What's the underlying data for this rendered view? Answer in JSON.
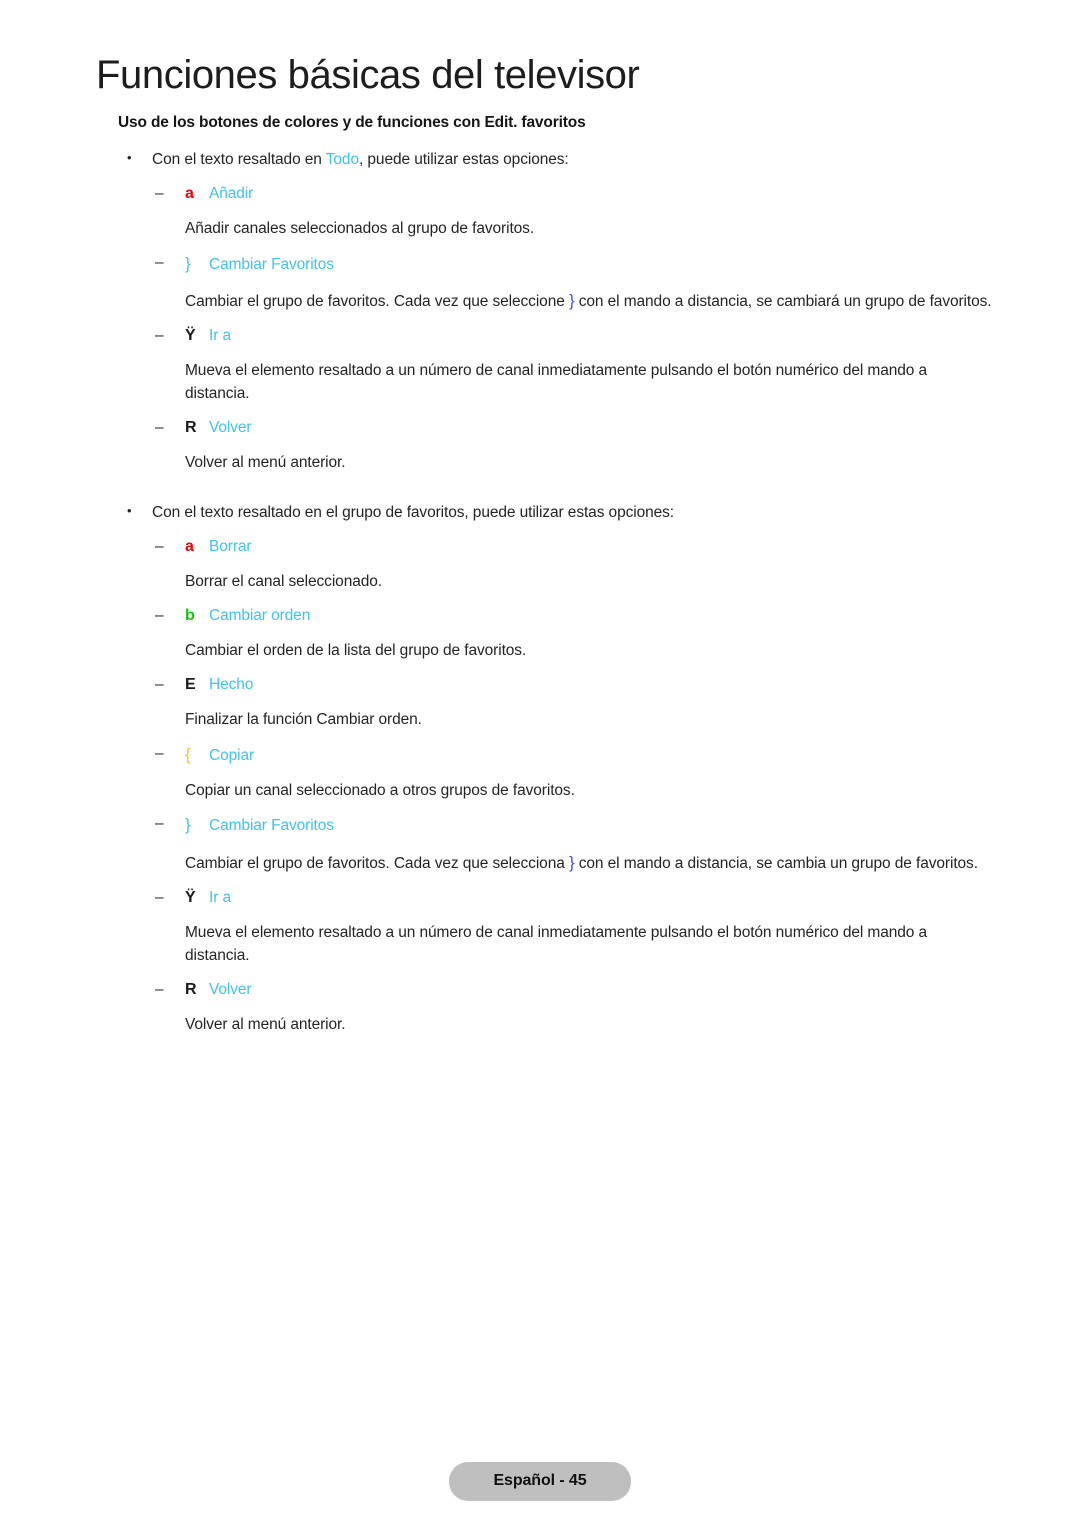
{
  "document": {
    "title": "Funciones básicas del televisor",
    "subheading": "Uso de los botones de colores y de funciones con Edit. favoritos"
  },
  "colors": {
    "cyan": "#3fc3f0",
    "red": "#fb0007",
    "green": "#14c40d",
    "yellow": "#fec31b",
    "blue": "#3a56dc",
    "body_text": "#242424",
    "footer_badge_bg": "#bfbfbf"
  },
  "sections": [
    {
      "bullet_prefix": "Con el texto resaltado en ",
      "bullet_highlight": "Todo",
      "bullet_suffix": ", puede utilizar estas opciones:",
      "items": [
        {
          "symbol": "a",
          "symbol_color": "red",
          "label": "Añadir",
          "description_parts": [
            {
              "text": "Añadir canales seleccionados al grupo de favoritos."
            }
          ]
        },
        {
          "symbol": "}",
          "symbol_color": "cyan",
          "label": "Cambiar Favoritos",
          "description_parts": [
            {
              "text": "Cambiar el grupo de favoritos. Cada vez que seleccione "
            },
            {
              "text": "}",
              "color": "blue",
              "symbol": true
            },
            {
              "text": "  con el mando a distancia, se cambiará un grupo de favoritos."
            }
          ]
        },
        {
          "symbol": "Ÿ",
          "symbol_color": "black",
          "label": "Ir a",
          "description_parts": [
            {
              "text": "Mueva el elemento resaltado a un número de canal inmediatamente pulsando el botón numérico del mando a distancia."
            }
          ]
        },
        {
          "symbol": "R",
          "symbol_color": "black",
          "label": "Volver",
          "description_parts": [
            {
              "text": "Volver al menú anterior."
            }
          ]
        }
      ]
    },
    {
      "bullet_prefix": "Con el texto resaltado en el grupo de favoritos, puede utilizar estas opciones:",
      "bullet_highlight": "",
      "bullet_suffix": "",
      "items": [
        {
          "symbol": "a",
          "symbol_color": "red",
          "label": "Borrar",
          "description_parts": [
            {
              "text": "Borrar el canal seleccionado."
            }
          ]
        },
        {
          "symbol": "b",
          "symbol_color": "green",
          "label": "Cambiar orden",
          "description_parts": [
            {
              "text": "Cambiar el orden de la lista del grupo de favoritos."
            }
          ]
        },
        {
          "symbol": "E",
          "symbol_color": "black",
          "label": "Hecho",
          "description_parts": [
            {
              "text": "Finalizar la función Cambiar orden."
            }
          ]
        },
        {
          "symbol": "{",
          "symbol_color": "yellow",
          "label": "Copiar",
          "description_parts": [
            {
              "text": "Copiar un canal seleccionado a otros grupos de favoritos."
            }
          ]
        },
        {
          "symbol": "}",
          "symbol_color": "cyan",
          "label": "Cambiar Favoritos",
          "description_parts": [
            {
              "text": "Cambiar el grupo de favoritos. Cada vez que selecciona "
            },
            {
              "text": "}",
              "color": "blue",
              "symbol": true
            },
            {
              "text": "  con el mando a distancia, se cambia un grupo de favoritos."
            }
          ]
        },
        {
          "symbol": "Ÿ",
          "symbol_color": "black",
          "label": "Ir a",
          "description_parts": [
            {
              "text": "Mueva el elemento resaltado a un número de canal inmediatamente pulsando el botón numérico del mando a distancia."
            }
          ]
        },
        {
          "symbol": "R",
          "symbol_color": "black",
          "label": "Volver",
          "description_parts": [
            {
              "text": "Volver al menú anterior."
            }
          ]
        }
      ]
    }
  ],
  "footer": {
    "label": "Español - 45"
  }
}
